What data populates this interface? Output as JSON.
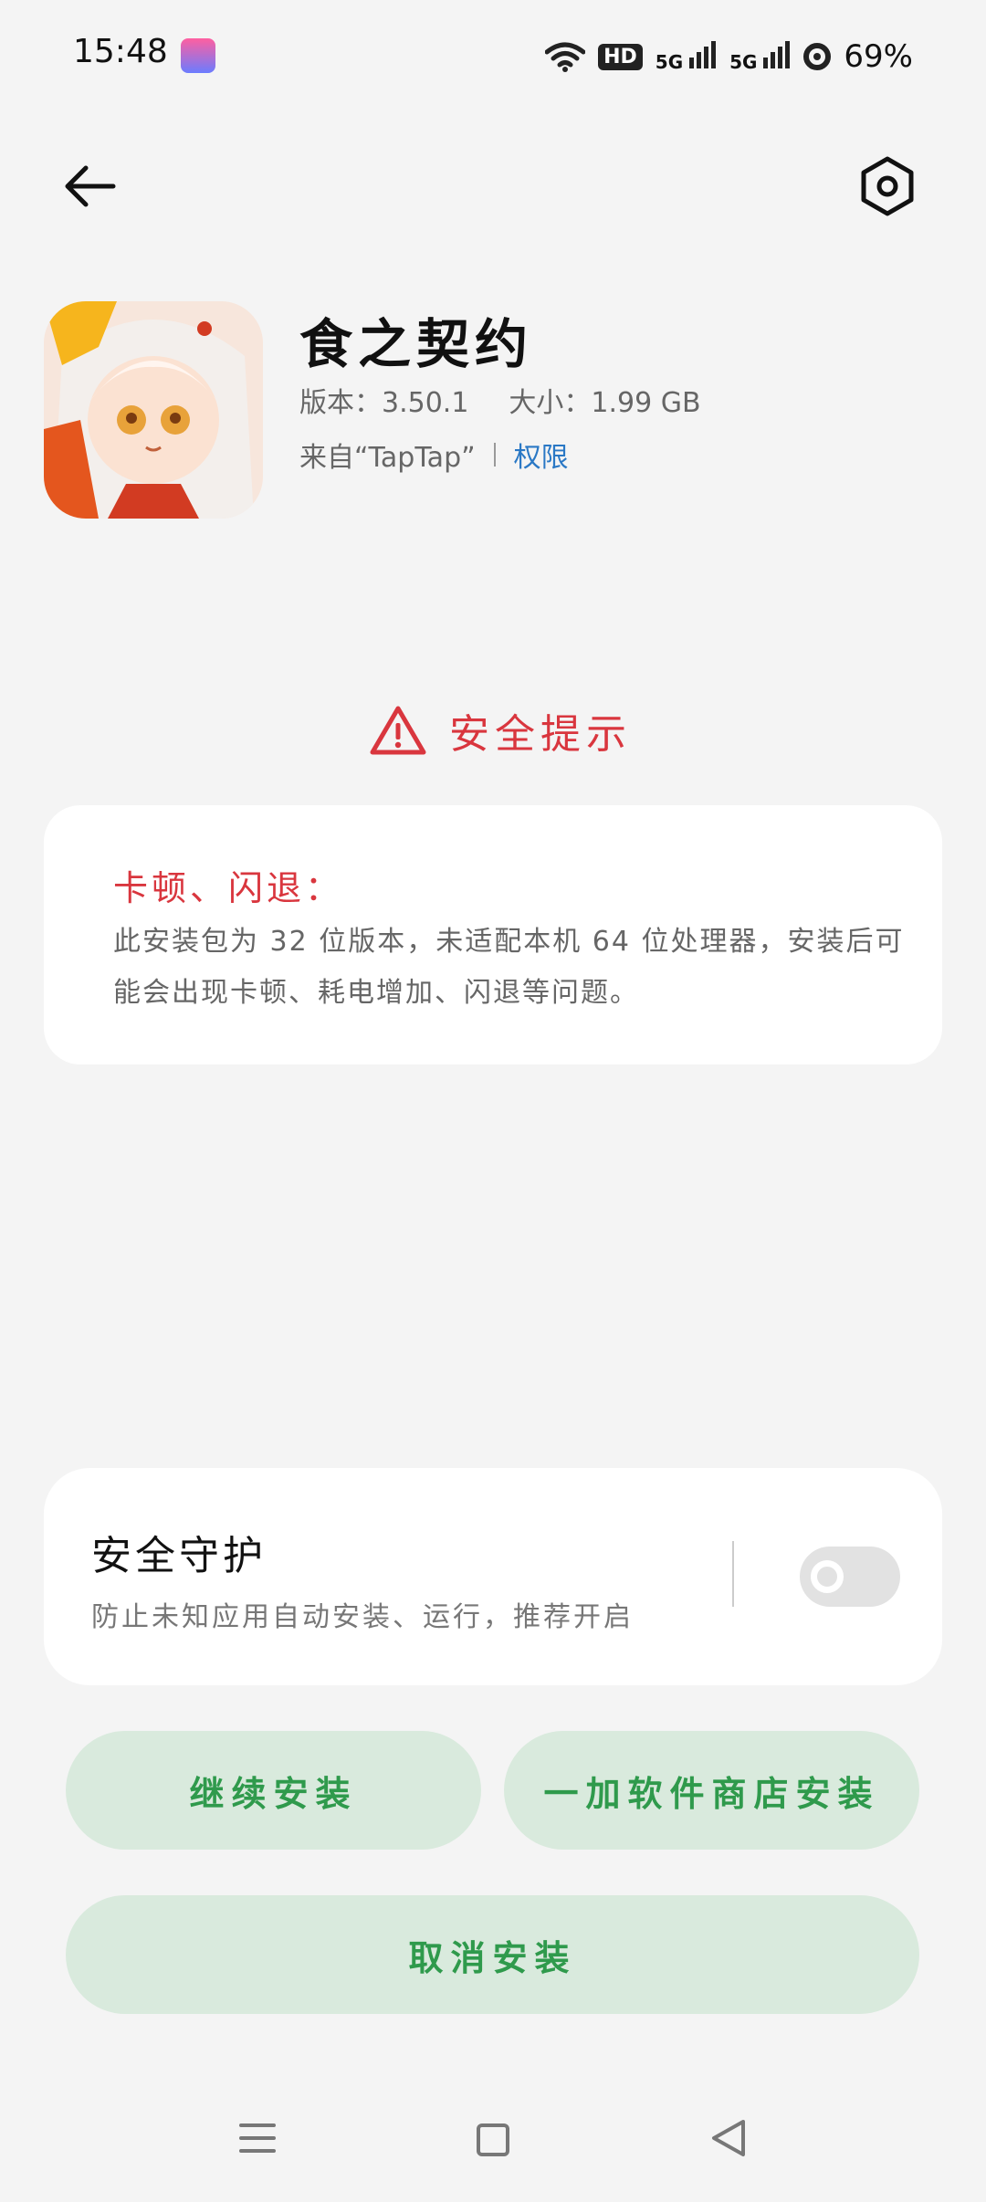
{
  "status_bar": {
    "time": "15:48",
    "hd_label": "HD",
    "signal1": "5G",
    "signal2": "5G",
    "battery": "69%",
    "notification_app_icon": "bilibili-icon"
  },
  "header": {
    "back_icon": "back-arrow-icon",
    "settings_icon": "settings-hexagon-icon"
  },
  "app": {
    "name": "食之契约",
    "version": "版本：3.50.1",
    "size": "大小：1.99 GB",
    "source": "来自“TapTap”",
    "permissions_link": "权限"
  },
  "security_tip": {
    "title": "安全提示",
    "icon": "warning-triangle-icon",
    "heading": "卡顿、闪退：",
    "body": "此安装包为 32 位版本，未适配本机 64 位处理器，安装后可能会出现卡顿、耗电增加、闪退等问题。"
  },
  "protection": {
    "title": "安全守护",
    "description": "防止未知应用自动安装、运行，推荐开启",
    "enabled": false
  },
  "buttons": {
    "continue": "继续安装",
    "store_install": "一加软件商店安装",
    "cancel": "取消安装"
  },
  "colors": {
    "background": "#f4f4f4",
    "warning_red": "#d9363e",
    "button_bg": "#d9eadd",
    "button_text": "#2f9a4c",
    "link_blue": "#2a78c5"
  }
}
